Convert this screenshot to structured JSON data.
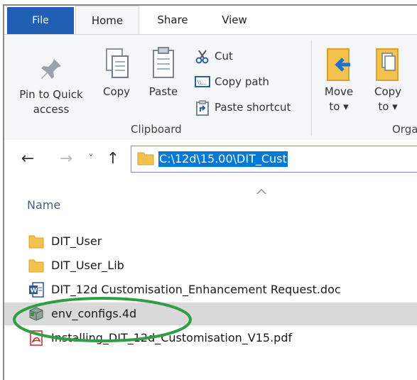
{
  "tabs": [
    {
      "label": "File"
    },
    {
      "label": "Home"
    },
    {
      "label": "Share"
    },
    {
      "label": "View"
    }
  ],
  "ribbon": {
    "pin_label_1": "Pin to Quick",
    "pin_label_2": "access",
    "copy_label": "Copy",
    "paste_label": "Paste",
    "cut_label": "Cut",
    "copy_path_label": "Copy path",
    "paste_shortcut_label": "Paste shortcut",
    "clipboard_group": "Clipboard",
    "move_to_1": "Move",
    "move_to_2": "to ▾",
    "copy_to_1": "Copy",
    "copy_to_2": "to ▾",
    "organize_group": "Orga"
  },
  "nav": {
    "back": "←",
    "forward": "→",
    "recent": "˅",
    "up": "↑",
    "path": "C:\\12d\\15.00\\DIT_Cust"
  },
  "list": {
    "column_name": "Name",
    "items": [
      {
        "name": "DIT_User",
        "type": "folder"
      },
      {
        "name": "DIT_User_Lib",
        "type": "folder"
      },
      {
        "name": "DIT_12d Customisation_Enhancement Request.doc",
        "type": "word"
      },
      {
        "name": "env_configs.4d",
        "type": "4d"
      },
      {
        "name": "Installing_DIT_12d_Customisation_V15.pdf",
        "type": "pdf"
      }
    ],
    "selected_index": 3
  },
  "colors": {
    "file_tab": "#1f5fb4",
    "selection": "#0078d7",
    "annotation": "#2f9e44",
    "folder": "#f2c14e"
  }
}
